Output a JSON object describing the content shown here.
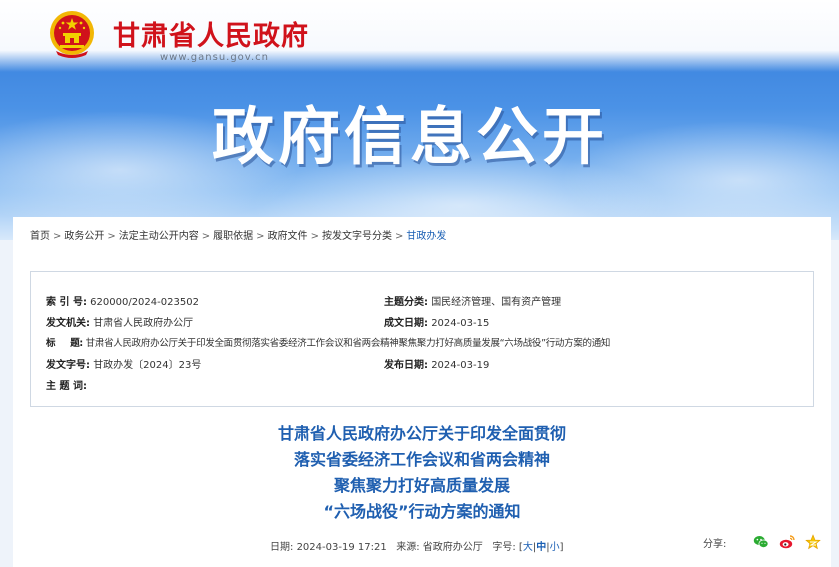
{
  "header": {
    "site_title": "甘肃省人民政府",
    "site_url": "www.gansu.gov.cn",
    "hero_title": "政府信息公开"
  },
  "breadcrumb": [
    {
      "label": "首页",
      "current": false
    },
    {
      "label": "政务公开",
      "current": false
    },
    {
      "label": "法定主动公开内容",
      "current": false
    },
    {
      "label": "履职依据",
      "current": false
    },
    {
      "label": "政府文件",
      "current": false
    },
    {
      "label": "按发文字号分类",
      "current": false
    },
    {
      "label": "甘政办发",
      "current": true
    }
  ],
  "breadcrumb_separator": ">",
  "meta": {
    "index_key": "索 引 号:",
    "index_val": "620000/2024-023502",
    "category_key": "主题分类:",
    "category_val": "国民经济管理、国有资产管理",
    "issuer_key": "发文机关:",
    "issuer_val": "甘肃省人民政府办公厅",
    "created_key": "成文日期:",
    "created_val": "2024-03-15",
    "title_key": "标     题:",
    "title_val": "甘肃省人民政府办公厅关于印发全面贯彻落实省委经济工作会议和省两会精神聚焦聚力打好高质量发展“六场战役”行动方案的通知",
    "doc_no_key": "发文字号:",
    "doc_no_val": "甘政办发〔2024〕23号",
    "published_key": "发布日期:",
    "published_val": "2024-03-19",
    "subject_key": "主 题 词:",
    "subject_val": ""
  },
  "document": {
    "title_lines": [
      "甘肃省人民政府办公厅关于印发全面贯彻",
      "落实省委经济工作会议和省两会精神",
      "聚焦聚力打好高质量发展",
      "“六场战役”行动方案的通知"
    ]
  },
  "info": {
    "date_label": "日期:",
    "date_val": "2024-03-19 17:21",
    "source_label": "来源:",
    "source_val": "省政府办公厅",
    "font_label": "字号:",
    "size_large": "大",
    "size_medium": "中",
    "size_small": "小"
  },
  "share": {
    "label": "分享:",
    "icons": [
      "wechat-icon",
      "weibo-icon",
      "qzone-icon"
    ]
  },
  "colors": {
    "brand_red": "#d0121b",
    "title_blue": "#1f5fb0",
    "link_blue": "#1a5fb4"
  }
}
